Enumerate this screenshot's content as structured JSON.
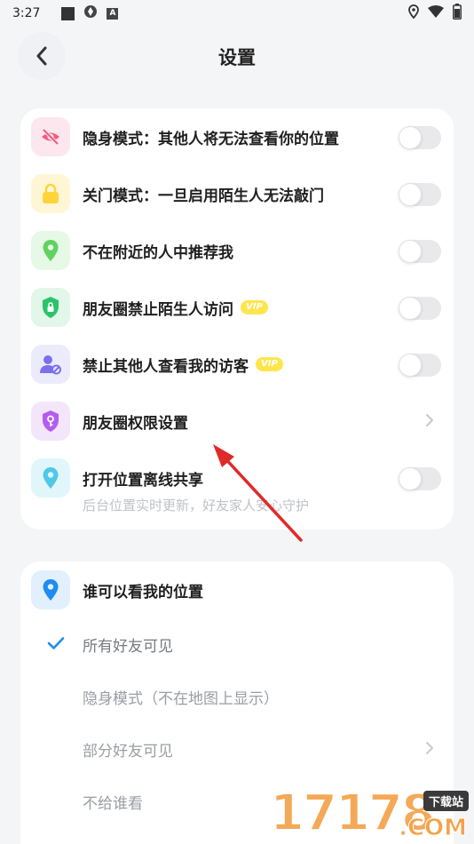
{
  "status_bar": {
    "time": "3:27",
    "icons": [
      "square-notification-icon",
      "pinwheel-icon",
      "a-badge-icon"
    ],
    "right_icons": [
      "location-icon",
      "wifi-icon",
      "battery-icon"
    ]
  },
  "header": {
    "title": "设置",
    "back_icon": "chevron-left-icon"
  },
  "privacy_card": {
    "items": [
      {
        "label": "隐身模式：其他人将无法查看你的位置",
        "icon": "eye-off-icon",
        "icon_bg": "#fde7ee",
        "icon_color": "#f25a84",
        "control": "toggle",
        "on": false
      },
      {
        "label": "关门模式：一旦启用陌生人无法敲门",
        "icon": "lock-icon",
        "icon_bg": "#fff6d6",
        "icon_color": "#ffd43b",
        "control": "toggle",
        "on": false
      },
      {
        "label": "不在附近的人中推荐我",
        "icon": "location-pin-icon",
        "icon_bg": "#e6f8e6",
        "icon_color": "#5fd35f",
        "control": "toggle",
        "on": false
      },
      {
        "label": "朋友圈禁止陌生人访问",
        "vip": "VIP",
        "icon": "shield-lock-icon",
        "icon_bg": "#e2f6ea",
        "icon_color": "#29c46a",
        "control": "toggle",
        "on": false
      },
      {
        "label": "禁止其他人查看我的访客",
        "vip": "VIP",
        "icon": "user-block-icon",
        "icon_bg": "#ecebfb",
        "icon_color": "#7c6ff0",
        "control": "toggle",
        "on": false
      },
      {
        "label": "朋友圈权限设置",
        "icon": "shield-key-icon",
        "icon_bg": "#f3e6fb",
        "icon_color": "#b45cf0",
        "control": "chevron"
      },
      {
        "label": "打开位置离线共享",
        "icon": "location-share-icon",
        "icon_bg": "#e1f6fb",
        "icon_color": "#4fc9e8",
        "control": "toggle",
        "on": false
      }
    ],
    "offline_share_hint": "后台位置实时更新，好友家人安心守护"
  },
  "visibility_card": {
    "title": "谁可以看我的位置",
    "icon": "location-pin-icon",
    "icon_bg": "#e2f0fd",
    "icon_color": "#1e8cf0",
    "options": [
      {
        "label": "所有好友可见",
        "selected": true
      },
      {
        "label": "隐身模式（不在地图上显示）",
        "selected": false
      },
      {
        "label": "部分好友可见",
        "selected": false,
        "has_chevron": true
      },
      {
        "label": "不给谁看",
        "selected": false
      }
    ]
  },
  "watermark": {
    "number": "17178",
    "badge": "下载站",
    "suffix": ".COM"
  },
  "colors": {
    "accent": "#1e8cf0",
    "annotation_arrow": "#e02a2a"
  }
}
